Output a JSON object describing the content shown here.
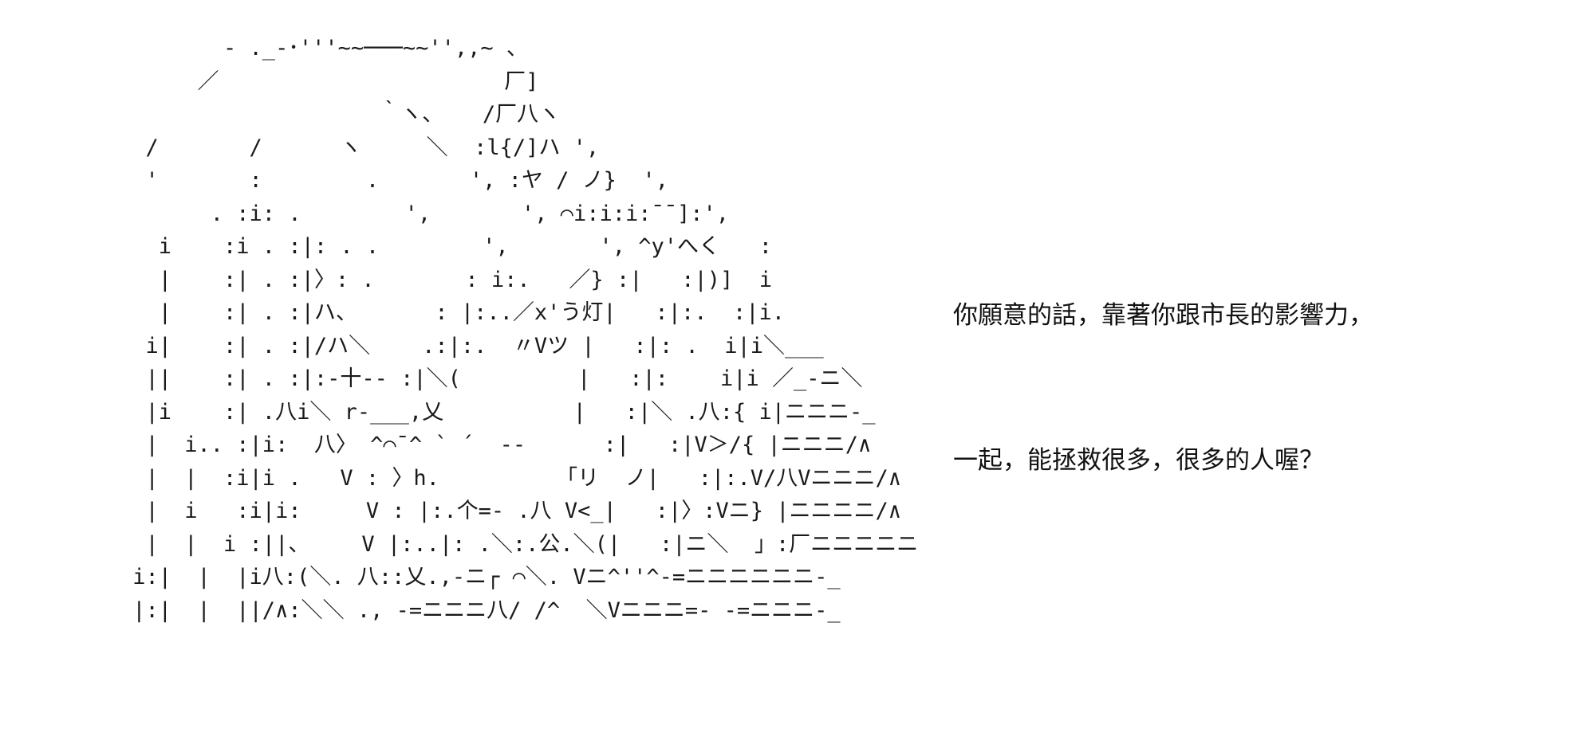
{
  "ascii_art": [
    "        ‐ ._-･'''~~───~~'',,~ 、",
    "      ／                      厂]",
    "                    ｀ヽ、   /厂八ヽ",
    "  /       /      ヽ     ＼  :l{/]ハ ',",
    "  '       :        .       ', :ヤ / ノ}  ',",
    "       . :i: .        ',       ', ⌒i:i:i:¯¯]:',",
    "   i    :i . :|: . .        ',       ', ^y'へく   :",
    "   |    :| . :|〉: .       : i:.   ／} :|   :|)]  i",
    "   |    :| . :|ハ、      : |:..／x'う灯|   :|:.  :|i.",
    "  i|    :| . :|/ハ＼    .:|:.  〃Vツ |   :|: .  i|i＼___",
    "  ||    :| . :|:-十-- :|＼(         |   :|:    i|i ／_-ニ＼",
    "  |i    :| .八i＼ r-___,乂          |   :|＼ .八:{ i|ニニニ-_",
    "  |  i.. :|i:  八〉 ^⌒¯^ ` ´  --      :|   :|V＞/{ |ニニニ/∧",
    "  |  |  :i|i .   V : 〉h.         「リ  ノ|   :|:.V/八Vニニニ/∧",
    "  |  i   :i|i:     V : |:.个=- .八 V<_|   :|〉:Vニ} |ニニニニ/∧",
    "  |  |  i :||、    V |:..|: .＼:.公.＼(|   :|ニ＼  」:厂ニニニニニ-_",
    " i:|  |  |i八:(＼. 八::乂.,-ニ┌ ⌒＼. Vニ^''^-=ニニニニニニ-_",
    " |:|  |  ||/∧:＼＼ ., -=ニニニ八/ /^  ＼Vニニニ=- -=ニニニ-_"
  ],
  "dialogue": {
    "line_1": "你願意的話，靠著你跟市長的影響力，",
    "line_2": "一起，能拯救很多，很多的人喔？"
  }
}
